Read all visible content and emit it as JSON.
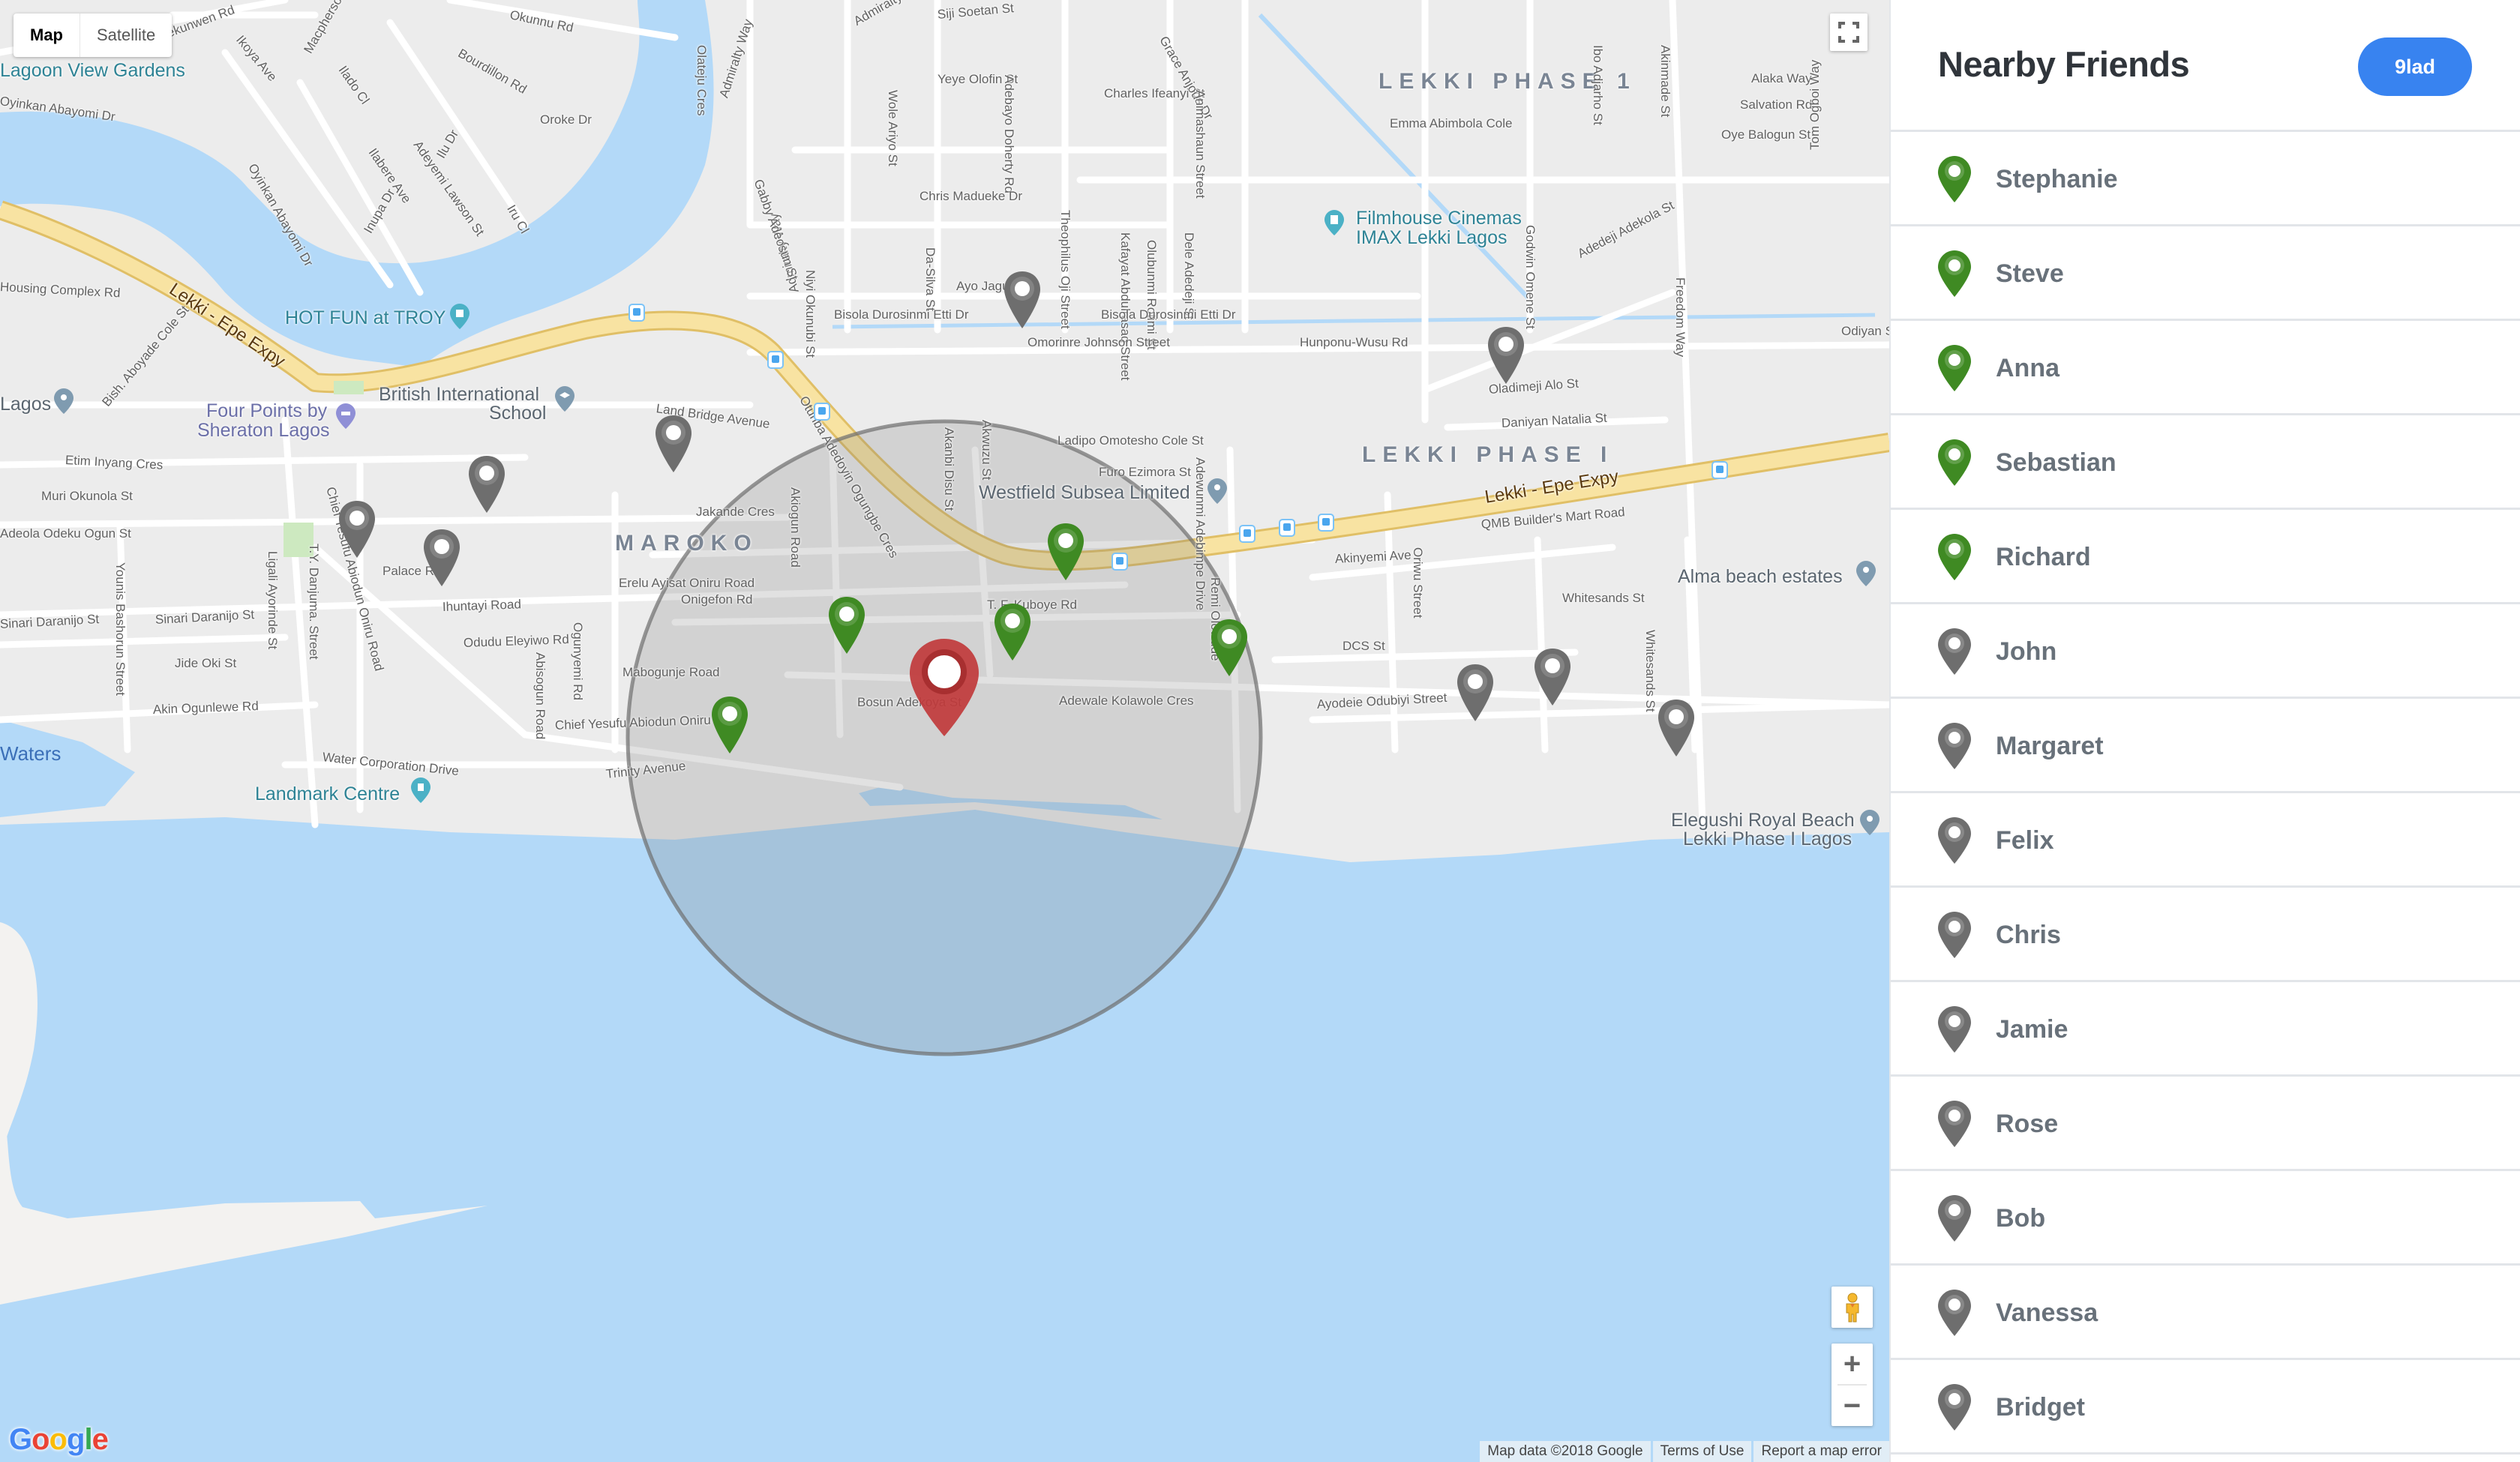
{
  "colors": {
    "online": "#3f8a23",
    "offline": "#6e6e6e",
    "self": "#c0393b",
    "accent": "#3883f0",
    "water": "#b3d9f8",
    "land": "#ececec",
    "highway": "#f8e3a2"
  },
  "map": {
    "type_control": {
      "map_label": "Map",
      "satellite_label": "Satellite",
      "selected": "Map"
    },
    "footer": {
      "attribution": "Map data ©2018 Google",
      "terms": "Terms of Use",
      "report": "Report a map error"
    },
    "logo": {
      "letters": [
        {
          "ch": "G",
          "color": "#4285f4"
        },
        {
          "ch": "o",
          "color": "#ea4335"
        },
        {
          "ch": "o",
          "color": "#fbbc05"
        },
        {
          "ch": "g",
          "color": "#4285f4"
        },
        {
          "ch": "l",
          "color": "#34a853"
        },
        {
          "ch": "e",
          "color": "#ea4335"
        }
      ]
    },
    "zoom_in_label": "+",
    "zoom_out_label": "−",
    "areas": [
      "LEKKI PHASE 1",
      "MAROKO",
      "LEKKI PHASE I"
    ],
    "places": [
      "Lagoon View Gardens",
      "HOT FUN at TROY",
      "British International School",
      "Four Points by Sheraton Lagos",
      "Filmhouse Cinemas IMAX Lekki Lagos",
      "Westfield Subsea Limited",
      "Alma beach estates",
      "Elegushi Royal Beach Lekki Phase I Lagos",
      "Landmark Centre",
      "Lagos",
      "Waters"
    ],
    "labels": {
      "lagoon_view": "Lagoon View Gardens",
      "hot_fun": "HOT FUN at TROY",
      "british_1": "British International",
      "british_2": "School",
      "four_points_1": "Four Points by",
      "four_points_2": "Sheraton Lagos",
      "filmhouse_1": "Filmhouse Cinemas",
      "filmhouse_2": "IMAX Lekki Lagos",
      "westfield": "Westfield Subsea Limited",
      "alma": "Alma beach estates",
      "elegushi_1": "Elegushi Royal Beach",
      "elegushi_2": "Lekki Phase I Lagos",
      "landmark": "Landmark Centre",
      "lagos": "Lagos",
      "waters": "Waters",
      "lekki_phase_1": "LEKKI PHASE 1",
      "maroko": "MAROKO",
      "lekki_phase_i": "LEKKI PHASE I",
      "hwy_1": "Lekki - Epe Expy",
      "hwy_2": "Lekki - Epe Expy",
      "mekunwen": "Mekunwen Rd",
      "ikoya": "Ikoya Ave",
      "macpherson": "Macpherson",
      "ilado": "Ilado Cl",
      "bourdillon": "Bourdillon Rd",
      "okunnu": "Okunnu Rd",
      "adeyemi": "Adeyemi Lawson St",
      "oyinkan1": "Oyinkan Abayomi Dr",
      "oyinkan2": "Oyinkan Abayomi Dr",
      "ilabere": "Ilabere Ave",
      "ilu": "Ilu Dr",
      "inupa": "Inupa Dr",
      "iru": "Iru Cl",
      "oroke": "Oroke Dr",
      "olateju": "Olateju Cres",
      "admiralty1": "Admiralty Way",
      "admiralty2": "Admiralty Way",
      "admiralty3": "Admiralty Way",
      "gabby": "Gabby Adeosun St",
      "wole": "Wole Ariyo St",
      "siji": "Siji Soetan St",
      "yeye": "Yeye Olofin St",
      "charles": "Charles Ifeanyi St",
      "doherty": "Adebayo Doherty Rd",
      "anjous": "Grace Anjous Dr",
      "animashaun": "Animashaun Street",
      "emma": "Emma Abimbola Cole",
      "chris": "Chris Madueke Dr",
      "niyi": "Niyi Okunubi St",
      "dasilva": "Da-Silva St",
      "theophilus": "Theophilus Oji Street",
      "kafayat": "Kafayat Abdulrasaq Street",
      "olubunmi": "Olubunmi Rotimi St",
      "dele": "Dele Adedeji St",
      "ayo": "Ayo Jagun St",
      "bisola1": "Bisola Durosinmi Etti Dr",
      "bisola2": "Bisola Durosinmi Etti Dr",
      "omorinre": "Omorinre Johnson Street",
      "hunponu": "Hunponu-Wusu Rd",
      "otunba": "Otunba Adedoyin Ogungbe Cres",
      "godwin": "Godwin Omene St",
      "adedeji": "Adedeji Adekola St",
      "freedom": "Freedom Way",
      "alaka": "Alaka Way",
      "salvation": "Salvation Rd",
      "oye": "Oye Balogun St",
      "tom": "Tom Ogboi Way",
      "odiyan": "Odiyan St",
      "adjarho": "Ibo Adjarho St",
      "akinmade": "Akinmade St",
      "oladimeji": "Oladimeji Alo St",
      "daniyan": "Daniyan Natalia St",
      "ladipo": "Ladipo Omotesho Cole St",
      "furo": "Furo Ezimora St",
      "akanbi": "Akanbi Disu St",
      "akwuzu": "Akwuzu St",
      "adebimpe": "Adewunmi Adebimpe Drive",
      "land_bridge": "Land Bridge Avenue",
      "jakande": "Jakande Cres",
      "akiogun": "Akiogun Road",
      "erelu": "Erelu Ayisat Oniru Road",
      "onigefon": "Onigefon Rd",
      "kuboye": "T. F. Kuboye Rd",
      "mabogunje": "Mabogunje Road",
      "bosun": "Bosun Adekoya St",
      "adewale": "Adewale Kolawole Cres",
      "oniru": "Chief Yesufu Abiodun Oniru Rd",
      "trinity": "Trinity Avenue",
      "remi": "Remi Olowude",
      "qmb": "QMB Builder's Mart Road",
      "akinyemi": "Akinyemi Ave",
      "oriwu": "Oriwu Street",
      "whitesands1": "Whitesands St",
      "whitesands2": "Whitesands St",
      "dcs": "DCS St",
      "ayodele": "Ayodeie Odubiyi Street",
      "housing": "Housing Complex Rd",
      "aboyade": "Bish. Aboyade Cole St",
      "etim": "Etim Inyang Cres",
      "muri": "Muri Okunola St",
      "ogun": "Adeola Odeku Ogun St",
      "chief_yesufu": "Chief Yesufu Abiodun Oniru Road",
      "ty": "T.Y. Danjuma. Street",
      "ligali": "Ligali Ayorinde St",
      "younis": "Younis Bashorun Street",
      "sinari1": "Sinari Daranijo St",
      "sinari2": "Sinari Daranijo St",
      "jide": "Jide Oki St",
      "akin": "Akin Ogunlewe Rd",
      "palace": "Palace Rd",
      "ihuntayi": "Ihuntayi Road",
      "odudu": "Odudu Eleyiwo Rd",
      "abisogun": "Abisogun Road",
      "ogunyemi": "Ogunyemi Rd",
      "water_corp": "Water Corporation Drive"
    },
    "radius_circle": {
      "label": "search-radius"
    },
    "markers": {
      "self": {
        "status": "self"
      },
      "friends": [
        {
          "status": "online"
        },
        {
          "status": "online"
        },
        {
          "status": "online"
        },
        {
          "status": "online"
        },
        {
          "status": "online"
        },
        {
          "status": "offline"
        },
        {
          "status": "offline"
        },
        {
          "status": "offline"
        },
        {
          "status": "offline"
        },
        {
          "status": "offline"
        },
        {
          "status": "offline"
        },
        {
          "status": "offline"
        },
        {
          "status": "offline"
        },
        {
          "status": "offline"
        }
      ]
    }
  },
  "sidebar": {
    "title": "Nearby Friends",
    "user_button": "9lad",
    "friends": [
      {
        "name": "Stephanie",
        "status": "online"
      },
      {
        "name": "Steve",
        "status": "online"
      },
      {
        "name": "Anna",
        "status": "online"
      },
      {
        "name": "Sebastian",
        "status": "online"
      },
      {
        "name": "Richard",
        "status": "online"
      },
      {
        "name": "John",
        "status": "offline"
      },
      {
        "name": "Margaret",
        "status": "offline"
      },
      {
        "name": "Felix",
        "status": "offline"
      },
      {
        "name": "Chris",
        "status": "offline"
      },
      {
        "name": "Jamie",
        "status": "offline"
      },
      {
        "name": "Rose",
        "status": "offline"
      },
      {
        "name": "Bob",
        "status": "offline"
      },
      {
        "name": "Vanessa",
        "status": "offline"
      },
      {
        "name": "Bridget",
        "status": "offline"
      }
    ]
  }
}
